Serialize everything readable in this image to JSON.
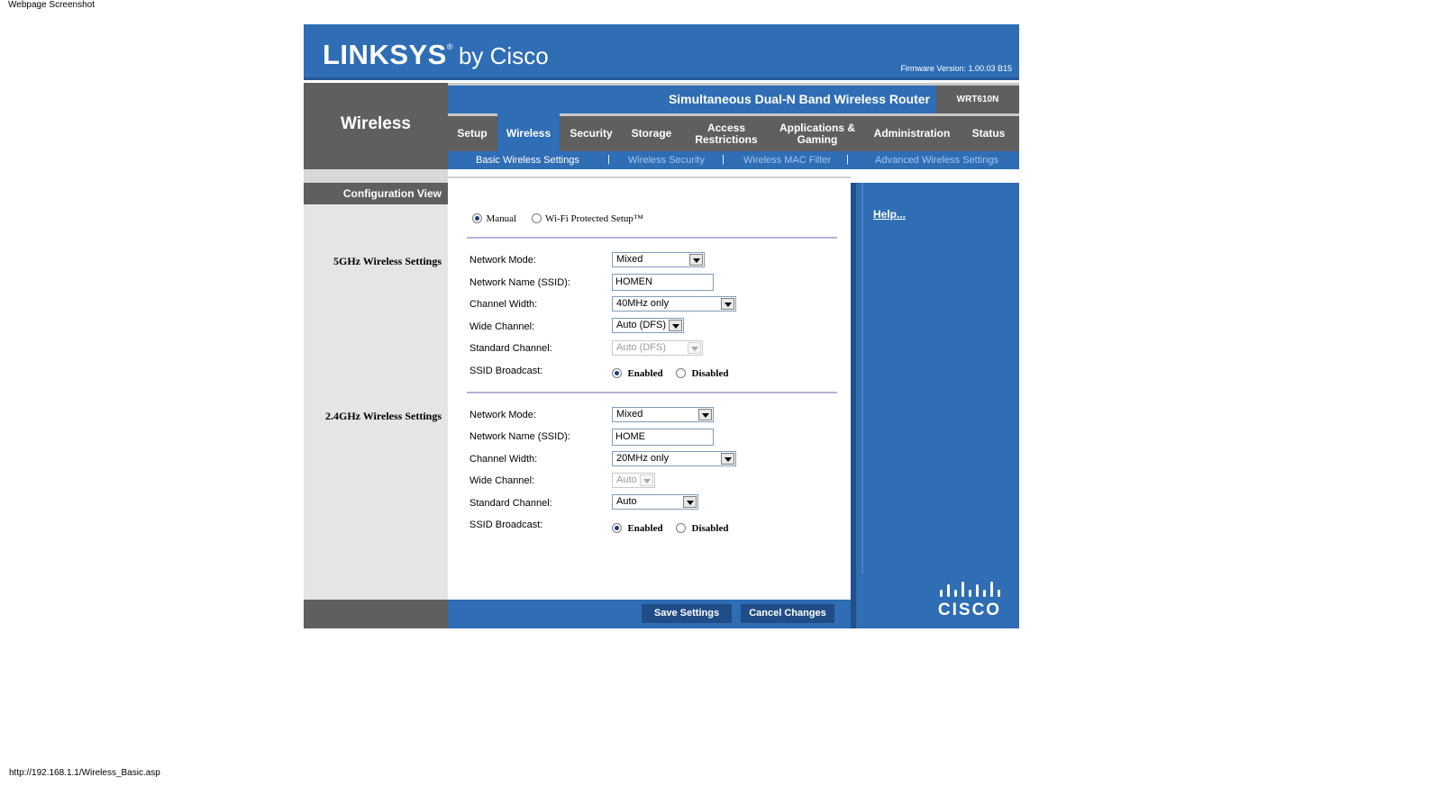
{
  "caption": "Webpage Screenshot",
  "url": "http://192.168.1.1/Wireless_Basic.asp",
  "brand": {
    "name": "LINKSYS",
    "registered": "®",
    "suffix": "by Cisco",
    "firmware": "Firmware Version: 1.00.03 B15",
    "cisco_logo_text": "CISCO"
  },
  "product": {
    "name": "Simultaneous Dual-N Band Wireless Router",
    "model": "WRT610N"
  },
  "section_title": "Wireless",
  "tabs": [
    {
      "label": "Setup"
    },
    {
      "label": "Wireless"
    },
    {
      "label": "Security"
    },
    {
      "label": "Storage"
    },
    {
      "label": "Access Restrictions"
    },
    {
      "label": "Applications & Gaming"
    },
    {
      "label": "Administration"
    },
    {
      "label": "Status"
    }
  ],
  "active_tab": "Wireless",
  "subtabs": [
    {
      "label": "Basic Wireless Settings"
    },
    {
      "label": "Wireless Security"
    },
    {
      "label": "Wireless MAC Filter"
    },
    {
      "label": "Advanced Wireless Settings"
    }
  ],
  "separator": "|",
  "config_view": "Configuration View",
  "setup_mode": {
    "manual": "Manual",
    "wps": "Wi-Fi Protected Setup™",
    "selected": "Manual"
  },
  "band5": {
    "heading": "5GHz Wireless Settings",
    "network_mode_label": "Network Mode:",
    "network_mode": "Mixed",
    "ssid_label": "Network Name (SSID):",
    "ssid": "HOMEN",
    "channel_width_label": "Channel Width:",
    "channel_width": "40MHz only",
    "wide_channel_label": "Wide Channel:",
    "wide_channel": "Auto (DFS)",
    "standard_channel_label": "Standard Channel:",
    "standard_channel": "Auto (DFS)",
    "ssid_broadcast_label": "SSID Broadcast:",
    "enabled": "Enabled",
    "disabled": "Disabled"
  },
  "band24": {
    "heading": "2.4GHz Wireless Settings",
    "network_mode_label": "Network Mode:",
    "network_mode": "Mixed",
    "ssid_label": "Network Name (SSID):",
    "ssid": "HOME",
    "channel_width_label": "Channel Width:",
    "channel_width": "20MHz only",
    "wide_channel_label": "Wide Channel:",
    "wide_channel": "Auto",
    "standard_channel_label": "Standard Channel:",
    "standard_channel": "Auto",
    "ssid_broadcast_label": "SSID Broadcast:",
    "enabled": "Enabled",
    "disabled": "Disabled"
  },
  "help": "Help...",
  "buttons": {
    "save": "Save Settings",
    "cancel": "Cancel Changes"
  },
  "colors": {
    "brand_blue": "#2f6db5",
    "dark_grey": "#5f5f5f",
    "light_grey": "#e5e5e5",
    "button": "#214d86"
  }
}
